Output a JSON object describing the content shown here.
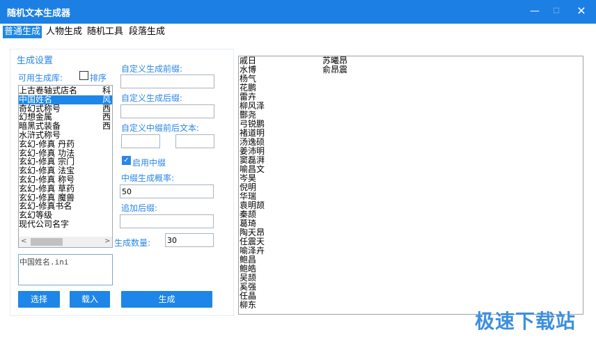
{
  "window": {
    "title": "随机文本生成器",
    "minimize": "—",
    "maximize": "☐",
    "close": "✕"
  },
  "menu": {
    "items": [
      "普通生成",
      "人物生成",
      "随机工具",
      "段落生成"
    ],
    "active": "普通生成"
  },
  "settings": {
    "group_title": "生成设置",
    "library_label": "可用生成库:",
    "sort_label": "排序",
    "sort_checked": false,
    "library_items": [
      {
        "name": "上古卷轴式店名",
        "col2": "科"
      },
      {
        "name": "中国姓名",
        "col2": "风",
        "selected": true
      },
      {
        "name": "奇幻式称号",
        "col2": "西"
      },
      {
        "name": "幻想金属",
        "col2": "西"
      },
      {
        "name": "暗黑式装备",
        "col2": "西"
      },
      {
        "name": "水浒式称号",
        "col2": ""
      },
      {
        "name": "玄幻-修真 丹药",
        "col2": ""
      },
      {
        "name": "玄幻-修真 功法",
        "col2": ""
      },
      {
        "name": "玄幻-修真 宗门",
        "col2": ""
      },
      {
        "name": "玄幻-修真 法宝",
        "col2": ""
      },
      {
        "name": "玄幻-修真 称号",
        "col2": ""
      },
      {
        "name": "玄幻-修真 草药",
        "col2": ""
      },
      {
        "name": "玄幻-修真 魔兽",
        "col2": ""
      },
      {
        "name": "玄幻-修真书名",
        "col2": ""
      },
      {
        "name": "玄幻等级",
        "col2": ""
      },
      {
        "name": "现代公司名字",
        "col2": ""
      }
    ],
    "file_name": "中国姓名.ini",
    "select_button": "选择",
    "load_button": "载入",
    "prefix_label": "自定义生成前缀:",
    "prefix_value": "",
    "suffix_label": "自定义生成后缀:",
    "suffix_value": "",
    "infix_text_label": "自定义中缀前后文本:",
    "infix_before": "",
    "infix_after": "",
    "enable_infix_label": "启用中缀",
    "enable_infix_checked": true,
    "infix_prob_label": "中缀生成概率:",
    "infix_prob_value": "50",
    "append_suffix_label": "追加后缀:",
    "append_suffix_value": "",
    "count_label": "生成数量:",
    "count_value": "30",
    "generate_button": "生成"
  },
  "output": {
    "column1": [
      "戚日",
      "水博",
      "杨气",
      "花鹏",
      "雷卉",
      "柳风泽",
      "酆尧",
      "弓锐鹏",
      "褚道明",
      "汤逸硕",
      "姜沛明",
      "窦磊湃",
      "喻昌文",
      "岑昊",
      "倪明",
      "华瑞",
      "袁明颉",
      "秦颉",
      "葛琦",
      "陶天昂",
      "任震天",
      "喻泽卉",
      "鲍昌",
      "鲍皓",
      "吴颉",
      "奚强",
      "任晶",
      "柳东"
    ],
    "column2": [
      "苏曦昂",
      "俞昂震"
    ]
  },
  "watermark": "极速下载站",
  "colors": {
    "titlebar": "#1c7fe4",
    "accent": "#1e86e8",
    "label_blue": "#2a86e8"
  }
}
